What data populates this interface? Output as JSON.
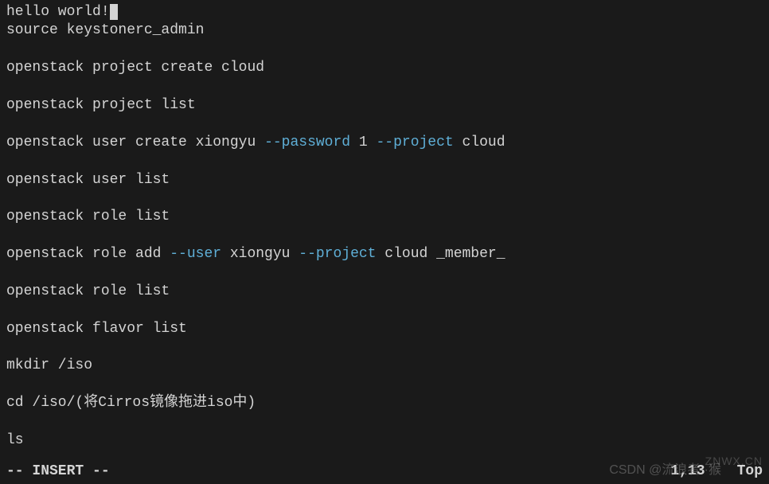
{
  "lines": [
    {
      "type": "text-cursor",
      "text": "hello world!"
    },
    {
      "type": "text",
      "text": "source keystonerc_admin"
    },
    {
      "type": "blank"
    },
    {
      "type": "text",
      "text": "openstack project create cloud"
    },
    {
      "type": "blank"
    },
    {
      "type": "text",
      "text": "openstack project list"
    },
    {
      "type": "blank"
    },
    {
      "type": "mixed",
      "parts": [
        {
          "text": "openstack user create xiongyu ",
          "class": ""
        },
        {
          "text": "--password",
          "class": "flag"
        },
        {
          "text": " 1 ",
          "class": ""
        },
        {
          "text": "--project",
          "class": "flag"
        },
        {
          "text": " cloud",
          "class": ""
        }
      ]
    },
    {
      "type": "blank"
    },
    {
      "type": "text",
      "text": "openstack user list"
    },
    {
      "type": "blank"
    },
    {
      "type": "text",
      "text": "openstack role list"
    },
    {
      "type": "blank"
    },
    {
      "type": "mixed",
      "parts": [
        {
          "text": "openstack role add ",
          "class": ""
        },
        {
          "text": "--user",
          "class": "flag"
        },
        {
          "text": " xiongyu ",
          "class": ""
        },
        {
          "text": "--project",
          "class": "flag"
        },
        {
          "text": " cloud _member_",
          "class": ""
        }
      ]
    },
    {
      "type": "blank"
    },
    {
      "type": "text",
      "text": "openstack role list"
    },
    {
      "type": "blank"
    },
    {
      "type": "text",
      "text": "openstack flavor list"
    },
    {
      "type": "blank"
    },
    {
      "type": "text",
      "text": "mkdir /iso"
    },
    {
      "type": "blank"
    },
    {
      "type": "text",
      "text": "cd /iso/(将Cirros镜像拖进iso中)"
    },
    {
      "type": "blank"
    },
    {
      "type": "text",
      "text": "ls"
    }
  ],
  "status": {
    "mode": "-- INSERT --",
    "position": "1,13",
    "scroll": "Top"
  },
  "watermark": "CSDN @流浪者··猴",
  "watermark2": "ZNWX.CN"
}
